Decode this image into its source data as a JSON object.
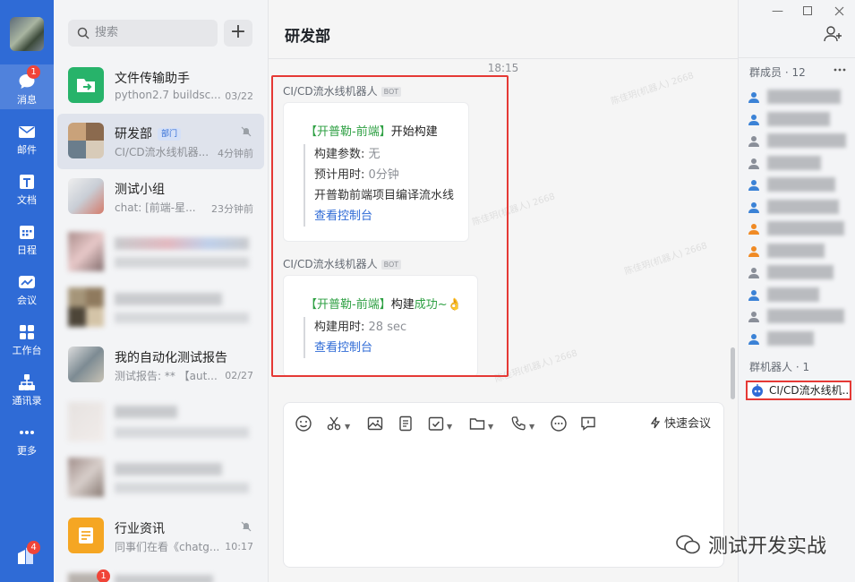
{
  "rail": {
    "items": [
      {
        "label": "消息",
        "badge": "1"
      },
      {
        "label": "邮件"
      },
      {
        "label": "文档"
      },
      {
        "label": "日程"
      },
      {
        "label": "会议"
      },
      {
        "label": "工作台"
      },
      {
        "label": "通讯录"
      },
      {
        "label": "更多"
      }
    ],
    "bottom_badge": "4"
  },
  "list": {
    "search_placeholder": "搜索",
    "add_label": "+",
    "conversations": [
      {
        "title": "文件传输助手",
        "snippet": "python2.7 buildsc...",
        "time": "03/22"
      },
      {
        "title": "研发部",
        "tag": "部门",
        "snippet": "CI/CD流水线机器...",
        "time": "4分钟前"
      },
      {
        "title": "测试小组",
        "snippet": "chat: [前端-星...",
        "time": "23分钟前"
      },
      {
        "title": "我的自动化测试报告",
        "snippet": "测试报告: ** 【aut...",
        "time": "02/27"
      },
      {
        "title": "行业资讯",
        "snippet": "同事们在看《chatg...",
        "time": "10:17"
      }
    ],
    "last_badge": "1"
  },
  "chat": {
    "title": "研发部",
    "time": "18:15",
    "bot_tag": "BOT",
    "messages": [
      {
        "sender": "CI/CD流水线机器人",
        "title_tag": "【开普勒-前端】",
        "title_rest": "开始构建",
        "lines": [
          {
            "k": "构建参数:",
            "v": "无"
          },
          {
            "k": "预计用时:",
            "v": "0分钟"
          },
          {
            "k": "开普勒前端项目编译流水线",
            "v": ""
          }
        ],
        "link": "查看控制台"
      },
      {
        "sender": "CI/CD流水线机器人",
        "title_tag": "【开普勒-前端】",
        "title_rest": "构建",
        "title_success": "成功~",
        "title_emoji": "👌",
        "lines": [
          {
            "k": "构建用时:",
            "v": "28 sec"
          }
        ],
        "link": "查看控制台"
      }
    ],
    "watermark": "陈佳玥(机器人) 2668",
    "quick_meeting": "快速会议"
  },
  "members": {
    "header": "群成员 · 12",
    "robot_header": "群机器人 · 1",
    "robot_name": "CI/CD流水线机..."
  },
  "footer_watermark": "测试开发实战",
  "colors": {
    "rail": "#2f6bd6",
    "accent_green": "#2ea043",
    "link": "#2f6bd6",
    "highlight_red": "#e53935"
  }
}
